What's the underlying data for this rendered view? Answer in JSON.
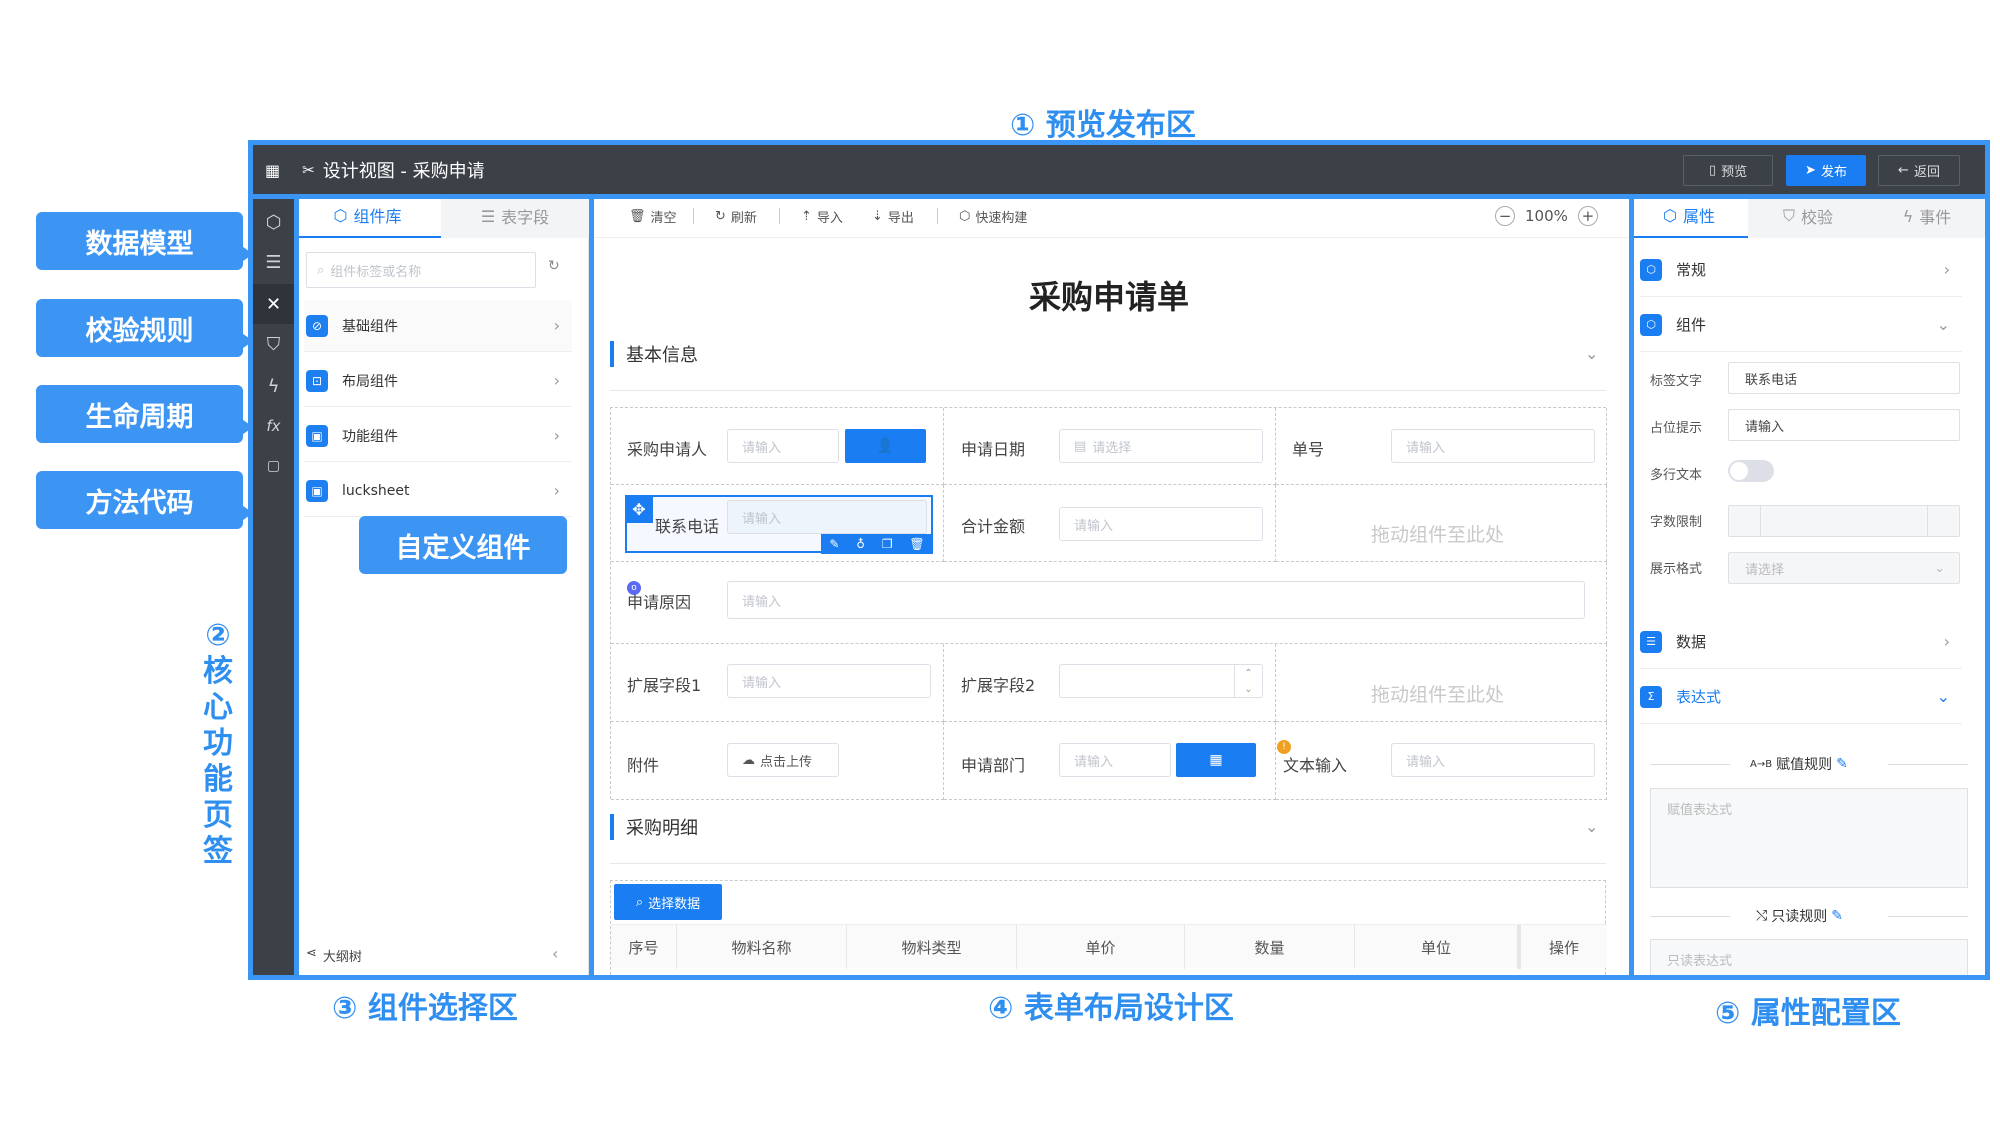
{
  "annotations": {
    "preview_publish": "① 预览发布区",
    "core_tabs": "②核心功能页签",
    "component_select": "③ 组件选择区",
    "form_layout": "④ 表单布局设计区",
    "property_config": "⑤ 属性配置区",
    "callouts": [
      "数据模型",
      "校验规则",
      "生命周期",
      "方法代码"
    ],
    "custom_component": "自定义组件"
  },
  "header": {
    "title": "设计视图 - 采购申请",
    "preview_label": "预览",
    "publish_label": "发布",
    "back_label": "返回"
  },
  "sidebar_icons": [
    "cube-icon",
    "database-icon",
    "tools-icon",
    "shield-icon",
    "bolt-icon",
    "fx-icon",
    "code-file-icon"
  ],
  "component_panel": {
    "tabs": [
      "组件库",
      "表字段"
    ],
    "search_placeholder": "组件标签或名称",
    "items": [
      "基础组件",
      "布局组件",
      "功能组件",
      "lucksheet"
    ],
    "outline_label": "大纲树"
  },
  "toolbar": {
    "clear": "清空",
    "refresh": "刷新",
    "import": "导入",
    "export": "导出",
    "quick_build": "快速构建",
    "zoom": "100%"
  },
  "form": {
    "title": "采购申请单",
    "section1": "基本信息",
    "section2": "采购明细",
    "placeholder_input": "请输入",
    "placeholder_select": "请选择",
    "drop_hint": "拖动组件至此处",
    "fields": {
      "applicant": "采购申请人",
      "apply_date": "申请日期",
      "order_no": "单号",
      "phone": "联系电话",
      "amount": "合计金额",
      "reason": "申请原因",
      "ext1": "扩展字段1",
      "ext2": "扩展字段2",
      "attachment": "附件",
      "upload": "点击上传",
      "department": "申请部门",
      "text_input": "文本输入"
    },
    "select_data": "选择数据",
    "table_headers": [
      "序号",
      "物料名称",
      "物料类型",
      "单价",
      "数量",
      "单位",
      "操作"
    ]
  },
  "props": {
    "tabs": [
      "属性",
      "校验",
      "事件"
    ],
    "groups": {
      "general": "常规",
      "component": "组件",
      "data": "数据",
      "expression": "表达式"
    },
    "fields": {
      "label_text": "标签文字",
      "label_value": "联系电话",
      "placeholder": "占位提示",
      "placeholder_value": "请输入",
      "multiline": "多行文本",
      "char_limit": "字数限制",
      "display_format": "展示格式",
      "display_value": "请选择"
    },
    "assign_rule": "赋值规则",
    "assign_placeholder": "赋值表达式",
    "readonly_rule": "只读规则",
    "readonly_placeholder": "只读表达式"
  },
  "colors": {
    "accent": "#1a7ef2",
    "frame": "#3b95f5",
    "dark": "#3c4148"
  }
}
